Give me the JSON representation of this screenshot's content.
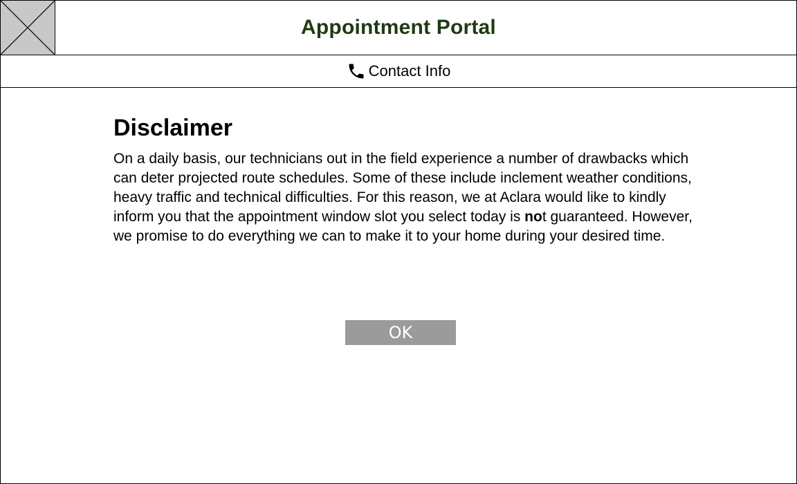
{
  "header": {
    "title": "Appointment Portal",
    "title_color": "#1f3a12",
    "logo_icon": "placeholder-image-icon"
  },
  "contact": {
    "icon": "phone-icon",
    "label": "Contact Info"
  },
  "disclaimer": {
    "heading": "Disclaimer",
    "text_before": "On a daily basis, our technicians out in the field experience a number of drawbacks which can deter projected route schedules. Some of these include inclement weather conditions, heavy traffic and technical difficulties. For this reason, we at Aclara would like to kindly inform you that the appointment window slot you select today is ",
    "text_bold": "no",
    "text_after": "t guaranteed. However, we promise to do everything we can to make it to your home during your desired time."
  },
  "actions": {
    "ok_label": "OK",
    "ok_color": "#9b9b9b"
  }
}
